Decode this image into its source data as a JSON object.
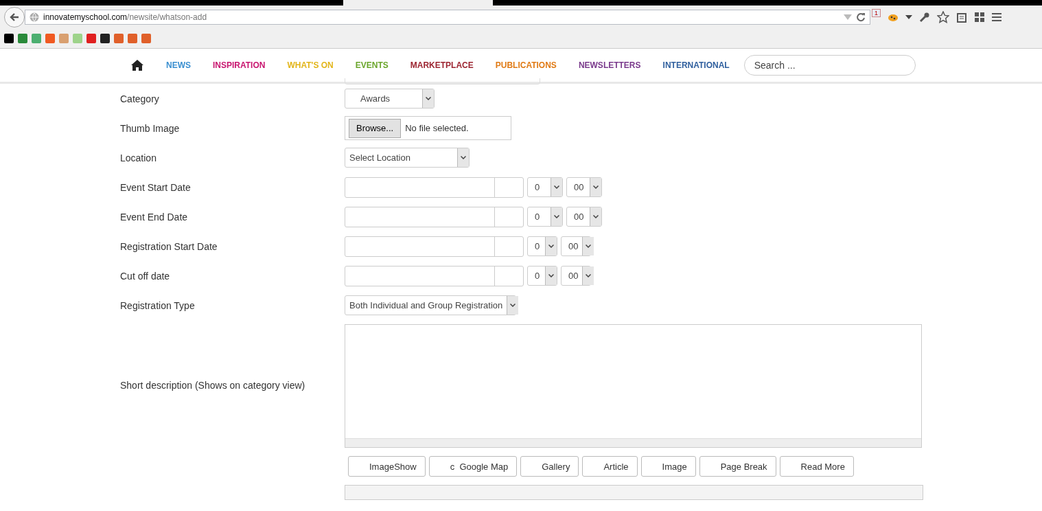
{
  "browser": {
    "url_host": "innovatemyschool.com",
    "url_path": "/newsite/whatson-add",
    "badge": "1"
  },
  "nav": {
    "items": [
      {
        "label": "NEWS",
        "color": "#3a8fd0"
      },
      {
        "label": "INSPIRATION",
        "color": "#c8156f"
      },
      {
        "label": "WHAT'S ON",
        "color": "#e2b51a"
      },
      {
        "label": "EVENTS",
        "color": "#6aa52a"
      },
      {
        "label": "MARKETPLACE",
        "color": "#9c2430"
      },
      {
        "label": "PUBLICATIONS",
        "color": "#e07a14"
      },
      {
        "label": "NEWSLETTERS",
        "color": "#7a3a8c"
      },
      {
        "label": "INTERNATIONAL",
        "color": "#2f5f9e"
      }
    ],
    "search_placeholder": "Search ..."
  },
  "form": {
    "rows": [
      {
        "kind": "select",
        "label": "Category",
        "value": "Awards"
      },
      {
        "kind": "file",
        "label": "Thumb Image",
        "button": "Browse...",
        "status": "No file selected."
      },
      {
        "kind": "select",
        "label": "Location",
        "value": "Select Location"
      },
      {
        "kind": "datetime",
        "label": "Event Start Date",
        "hour": "0",
        "minute": "00"
      },
      {
        "kind": "datetime",
        "label": "Event End Date",
        "hour": "0",
        "minute": "00"
      },
      {
        "kind": "datetime",
        "label": "Registration Start Date",
        "hour": "0",
        "minute": "00"
      },
      {
        "kind": "datetime",
        "label": "Cut off date",
        "hour": "0",
        "minute": "00"
      },
      {
        "kind": "select",
        "label": "Registration Type",
        "value": "Both Individual and Group Registration"
      },
      {
        "kind": "textarea",
        "label": "Short description (Shows on category view)"
      }
    ],
    "editor_buttons": [
      "ImageShow",
      "c  Google Map",
      "Gallery",
      "Article",
      "Image",
      "Page Break",
      "Read More"
    ]
  }
}
